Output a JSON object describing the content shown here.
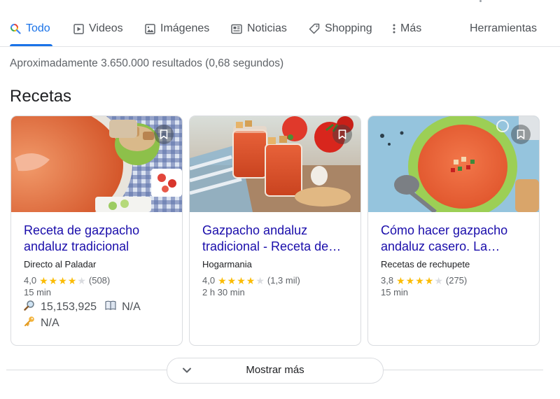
{
  "nav": {
    "tabs": [
      {
        "label": "Todo",
        "icon": "search-icon"
      },
      {
        "label": "Videos",
        "icon": "play-icon"
      },
      {
        "label": "Imágenes",
        "icon": "image-icon"
      },
      {
        "label": "Noticias",
        "icon": "news-icon"
      },
      {
        "label": "Shopping",
        "icon": "tag-icon"
      },
      {
        "label": "Más",
        "icon": "more-vert-icon"
      }
    ],
    "tools_label": "Herramientas",
    "active_color": "#1a73e8"
  },
  "results_stats": "Aproximadamente 3.650.000 resultados (0,68 segundos)",
  "section_title": "Recetas",
  "cards": [
    {
      "title_line1": "Receta de gazpacho",
      "title_line2": "andaluz tradicional",
      "source": "Directo al Paladar",
      "rating": "4,0",
      "stars": 4,
      "reviews": "(508)",
      "time": "15 min",
      "extra_views": "15,153,925",
      "extra_book": "N/A",
      "extra_key": "N/A"
    },
    {
      "title_line1": "Gazpacho andaluz",
      "title_line2": "tradicional - Receta de…",
      "source": "Hogarmania",
      "rating": "4,0",
      "stars": 4,
      "reviews": "(1,3 mil)",
      "time": "2 h 30 min"
    },
    {
      "title_line1": "Cómo hacer gazpacho",
      "title_line2": "andaluz casero. La…",
      "source": "Recetas de rechupete",
      "rating": "3,8",
      "stars": 4,
      "reviews": "(275)",
      "time": "15 min"
    }
  ],
  "show_more_label": "Mostrar más",
  "colors": {
    "link": "#1a0dab",
    "star": "#fbbc04",
    "accent": "#1a73e8"
  }
}
